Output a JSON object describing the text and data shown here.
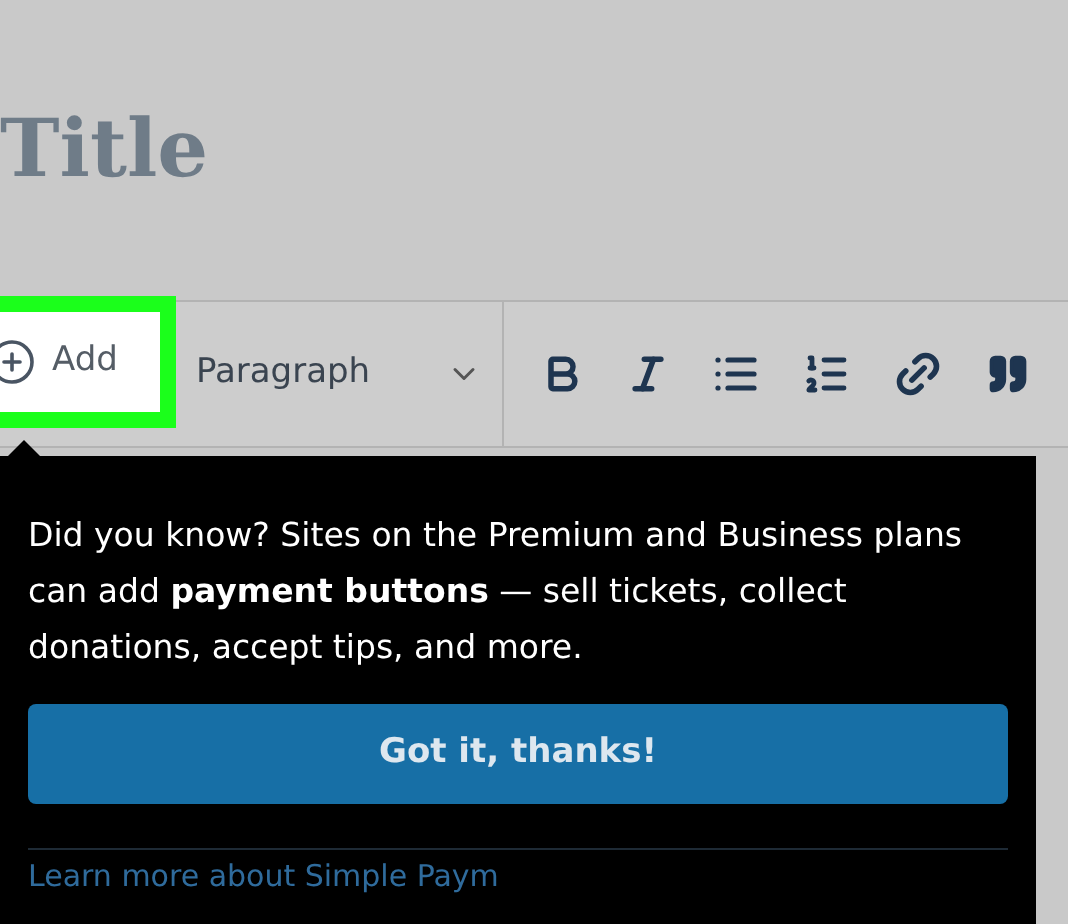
{
  "editor": {
    "title": "Title"
  },
  "toolbar": {
    "add_button": {
      "label": "Add",
      "highlighted": true
    },
    "block_type": "Paragraph"
  },
  "popover": {
    "message": "Did you know? Sites on the Premium and Business plans can add **payment buttons** — sell tickets, collect donations, accept tips, and more.",
    "button": "Got it, thanks!",
    "link": "Learn more about Simple Paym"
  }
}
